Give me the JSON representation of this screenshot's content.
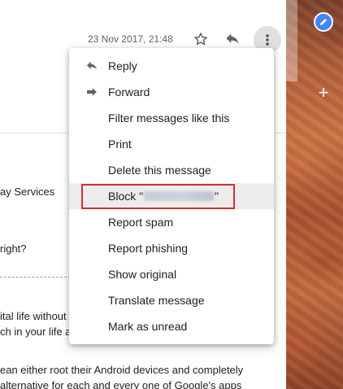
{
  "email": {
    "date": "23 Nov 2017, 21:48",
    "body_fragments": [
      "ay Services",
      "right?",
      "ital life without",
      "ch in your life a",
      "ean either root their Android devices and completely",
      "alternative for each and every one of Google's apps"
    ]
  },
  "menu": {
    "items": [
      {
        "label": "Reply",
        "icon": "reply-icon"
      },
      {
        "label": "Forward",
        "icon": "forward-icon"
      },
      {
        "label": "Filter messages like this",
        "icon": ""
      },
      {
        "label": "Print",
        "icon": ""
      },
      {
        "label": "Delete this message",
        "icon": ""
      },
      {
        "label_prefix": "Block \"",
        "label_suffix": "\"",
        "redacted": true
      },
      {
        "label": "Report spam",
        "icon": ""
      },
      {
        "label": "Report phishing",
        "icon": ""
      },
      {
        "label": "Show original",
        "icon": ""
      },
      {
        "label": "Translate message",
        "icon": ""
      },
      {
        "label": "Mark as unread",
        "icon": ""
      }
    ]
  },
  "colors": {
    "highlight_border": "#d32f2f",
    "accent_blue": "#4285f4",
    "hover_bg": "#ececec"
  },
  "icons": {
    "star": "star-icon",
    "reply": "reply-icon",
    "more": "more-vert-icon",
    "edit": "pencil-icon",
    "add": "plus-icon"
  }
}
